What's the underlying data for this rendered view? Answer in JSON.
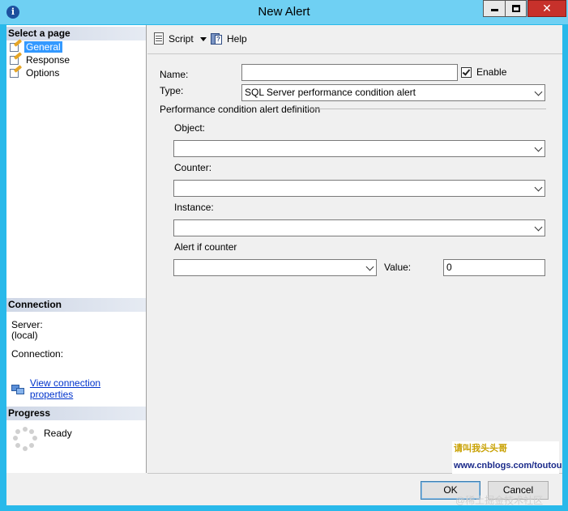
{
  "window": {
    "title": "New Alert",
    "close_glyph": "✕"
  },
  "left": {
    "select_page_header": "Select a page",
    "pages": [
      {
        "label": "General",
        "selected": true
      },
      {
        "label": "Response",
        "selected": false
      },
      {
        "label": "Options",
        "selected": false
      }
    ],
    "connection_header": "Connection",
    "server_label": "Server:",
    "server_value": "(local)",
    "connection_label": "Connection:",
    "view_connection_link": "View connection properties",
    "progress_header": "Progress",
    "progress_status": "Ready"
  },
  "toolbar": {
    "script_label": "Script",
    "help_label": "Help"
  },
  "form": {
    "name_label": "Name:",
    "name_value": "",
    "enable_label": "Enable",
    "enable_checked": true,
    "type_label": "Type:",
    "type_value": "SQL Server performance condition alert",
    "definition_header": "Performance condition alert definition",
    "object_label": "Object:",
    "object_value": "",
    "counter_label": "Counter:",
    "counter_value": "",
    "instance_label": "Instance:",
    "instance_value": "",
    "alert_if_label": "Alert if counter",
    "alert_if_value": "",
    "value_label": "Value:",
    "value_value": "0"
  },
  "footer": {
    "ok_label": "OK",
    "cancel_label": "Cancel"
  },
  "overlay": {
    "ad_top": "请叫我头头哥",
    "ad_url": "www.cnblogs.com/toutou",
    "watermark": "@稀土掘金技术社区"
  },
  "colors": {
    "titlebar": "#6fd0f3",
    "frame": "#29b9ea",
    "selection": "#3399ff",
    "link": "#0033cc"
  }
}
